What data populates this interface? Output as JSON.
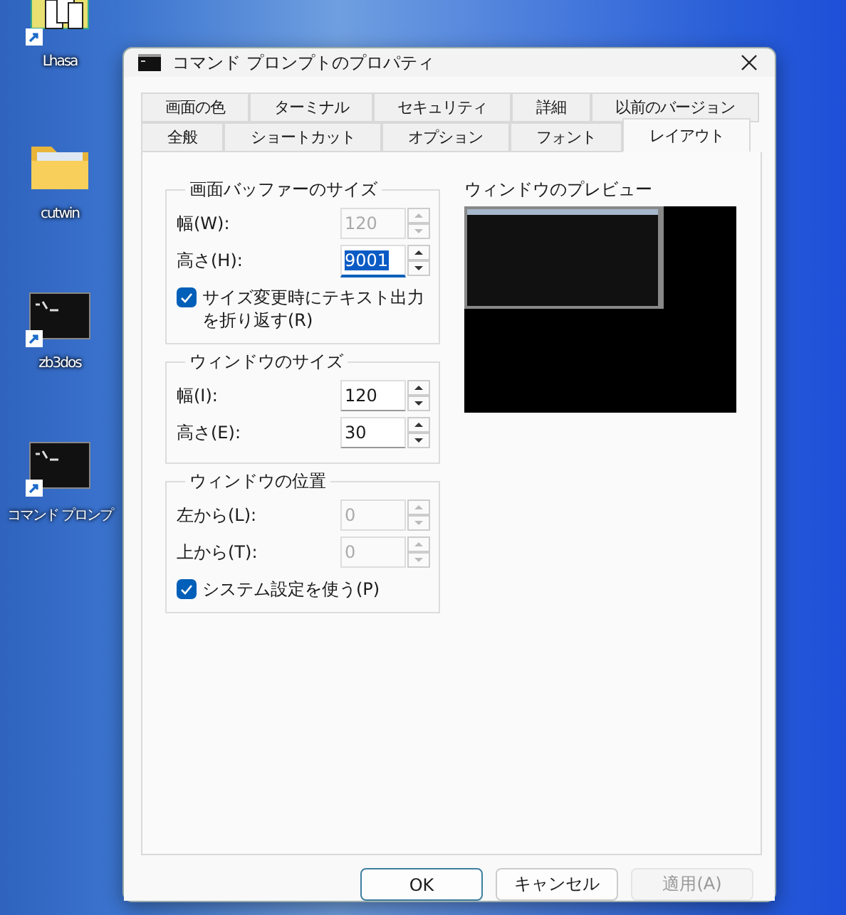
{
  "desktop_icons": [
    {
      "label": "Lhasa",
      "kind": "archive",
      "shortcut": true
    },
    {
      "label": "cutwin",
      "kind": "folder",
      "shortcut": false
    },
    {
      "label": "zb3dos",
      "kind": "console",
      "shortcut": true
    },
    {
      "label": "コマンド プロンプ",
      "kind": "console",
      "shortcut": true
    }
  ],
  "window": {
    "title": "コマンド プロンプトのプロパティ"
  },
  "tab_rows": [
    [
      {
        "label": "画面の色",
        "selected": false
      },
      {
        "label": "ターミナル",
        "selected": false
      },
      {
        "label": "セキュリティ",
        "selected": false
      },
      {
        "label": "詳細",
        "selected": false
      },
      {
        "label": "以前のバージョン",
        "selected": false
      }
    ],
    [
      {
        "label": "全般",
        "selected": false
      },
      {
        "label": "ショートカット",
        "selected": false
      },
      {
        "label": "オプション",
        "selected": false
      },
      {
        "label": "フォント",
        "selected": false
      },
      {
        "label": "レイアウト",
        "selected": true
      }
    ]
  ],
  "groups": [
    {
      "title": "画面バッファーのサイズ",
      "fields": [
        {
          "label": "幅(W):",
          "value": "120",
          "disabled": true,
          "focused": false
        },
        {
          "label": "高さ(H):",
          "value": "9001",
          "disabled": false,
          "focused": true
        }
      ],
      "checkbox": {
        "label": "サイズ変更時にテキスト出力を折り返す(R)",
        "checked": true
      }
    },
    {
      "title": "ウィンドウのサイズ",
      "fields": [
        {
          "label": "幅(I):",
          "value": "120",
          "disabled": false,
          "focused": false
        },
        {
          "label": "高さ(E):",
          "value": "30",
          "disabled": false,
          "focused": false
        }
      ]
    },
    {
      "title": "ウィンドウの位置",
      "fields": [
        {
          "label": "左から(L):",
          "value": "0",
          "disabled": true,
          "focused": false
        },
        {
          "label": "上から(T):",
          "value": "0",
          "disabled": true,
          "focused": false
        }
      ],
      "checkbox": {
        "label": "システム設定を使う(P)",
        "checked": true
      }
    }
  ],
  "preview": {
    "title": "ウィンドウのプレビュー"
  },
  "buttons": [
    {
      "label": "OK",
      "default": true,
      "disabled": false
    },
    {
      "label": "キャンセル",
      "default": false,
      "disabled": false
    },
    {
      "label": "適用(A)",
      "default": false,
      "disabled": true
    }
  ]
}
